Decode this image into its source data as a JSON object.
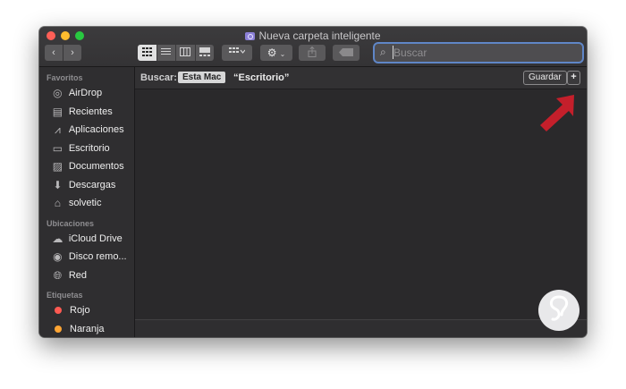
{
  "window": {
    "title": "Nueva carpeta inteligente"
  },
  "toolbar": {
    "back_icon": "‹",
    "forward_icon": "›",
    "view_icons": [
      "grid-icon",
      "list-icon",
      "columns-icon",
      "gallery-icon"
    ],
    "arrange_icon": "arrange-grid-icon",
    "action_icon": "gear-icon",
    "share_icon": "share-icon",
    "tag_icon": "tag-icon"
  },
  "search": {
    "placeholder": "Buscar"
  },
  "sidebar": {
    "favorites_title": "Favoritos",
    "favorites": [
      {
        "label": "AirDrop",
        "icon": "airdrop-icon"
      },
      {
        "label": "Recientes",
        "icon": "recents-icon"
      },
      {
        "label": "Aplicaciones",
        "icon": "applications-icon"
      },
      {
        "label": "Escritorio",
        "icon": "desktop-icon"
      },
      {
        "label": "Documentos",
        "icon": "documents-icon"
      },
      {
        "label": "Descargas",
        "icon": "downloads-icon"
      },
      {
        "label": "solvetic",
        "icon": "home-icon"
      }
    ],
    "locations_title": "Ubicaciones",
    "locations": [
      {
        "label": "iCloud Drive",
        "icon": "cloud-icon"
      },
      {
        "label": "Disco remo...",
        "icon": "disc-icon"
      },
      {
        "label": "Red",
        "icon": "network-icon"
      }
    ],
    "tags_title": "Etiquetas",
    "tags": [
      {
        "label": "Rojo",
        "color": "#ff5a52"
      },
      {
        "label": "Naranja",
        "color": "#ffa534"
      }
    ]
  },
  "search_bar": {
    "label": "Buscar:",
    "scope_this_mac": "Esta Mac",
    "scope_folder": "“Escritorio”",
    "save_label": "Guardar",
    "add_label": "+"
  },
  "colors": {
    "arrow": "#c41f2b",
    "search_focus": "#5f86c7"
  }
}
